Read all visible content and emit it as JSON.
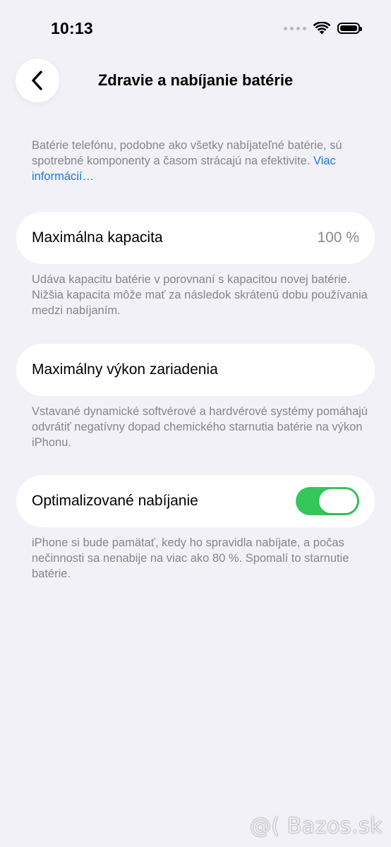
{
  "status_bar": {
    "time": "10:13",
    "icons": [
      "signal-dots-icon",
      "wifi-icon",
      "battery-icon"
    ]
  },
  "nav": {
    "back_icon": "chevron-left-icon",
    "title": "Zdravie a nabíjanie batérie"
  },
  "intro": {
    "text": "Batérie telefónu, podobne ako všetky nabíjateľné batérie, sú spotrebné komponenty a časom strácajú na efektivite.",
    "link": "Viac informácií…"
  },
  "max_capacity": {
    "label": "Maximálna kapacita",
    "value": "100 %",
    "note": "Udáva kapacitu batérie v porovnaní s kapacitou novej batérie. Nižšia kapacita môže mať za následok skrátenú dobu používania medzi nabíjaním."
  },
  "peak_performance": {
    "label": "Maximálny výkon zariadenia",
    "note": "Vstavané dynamické softvérové a hardvérové systémy pomáhajú odvrátiť negatívny dopad chemického starnutia batérie na výkon iPhonu."
  },
  "optimized_charging": {
    "label": "Optimalizované nabíjanie",
    "enabled": true,
    "note": "iPhone si bude pamätať, kedy ho spravidla nabíjate, a počas nečinnosti sa nenabije na viac ako 80 %. Spomalí to starnutie batérie."
  },
  "watermark": "@( Bazos.sk",
  "colors": {
    "background": "#f2f1f7",
    "card": "#ffffff",
    "link": "#1a7ad9",
    "toggle_on": "#34c759",
    "secondary_text": "#85858a"
  }
}
